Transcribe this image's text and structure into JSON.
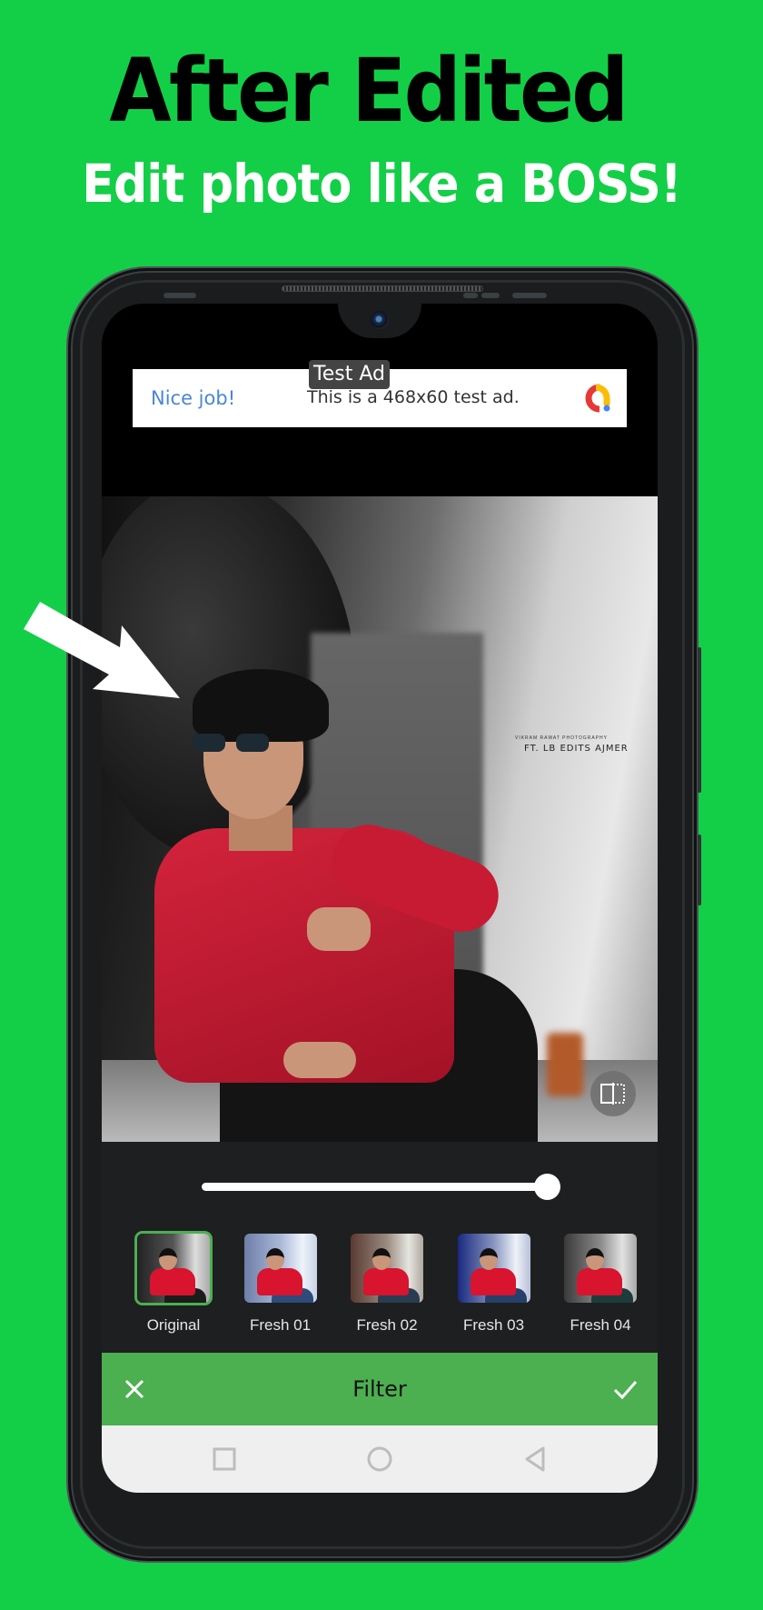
{
  "promo": {
    "headline": "After Edited",
    "subheadline": "Edit photo like a BOSS!"
  },
  "ad": {
    "label": "Test Ad",
    "cta": "Nice job!",
    "text": "This is a 468x60 test ad."
  },
  "photo": {
    "watermark_small": "VIKRAM RAWAT PHOTOGRAPHY",
    "watermark": "FT. LB EDITS AJMER",
    "compare_icon": "compare-split-icon"
  },
  "editor": {
    "intensity": 1.0,
    "filters": [
      {
        "label": "Original",
        "selected": true
      },
      {
        "label": "Fresh 01",
        "selected": false
      },
      {
        "label": "Fresh 02",
        "selected": false
      },
      {
        "label": "Fresh 03",
        "selected": false
      },
      {
        "label": "Fresh 04",
        "selected": false
      }
    ],
    "title": "Filter",
    "cancel_icon": "close-icon",
    "confirm_icon": "check-icon"
  },
  "colors": {
    "background": "#13cf47",
    "action_bar": "#4caf50",
    "panel": "#1e1f21",
    "ad_cta": "#4a86d8"
  },
  "system_nav": [
    "recents",
    "home",
    "back"
  ]
}
